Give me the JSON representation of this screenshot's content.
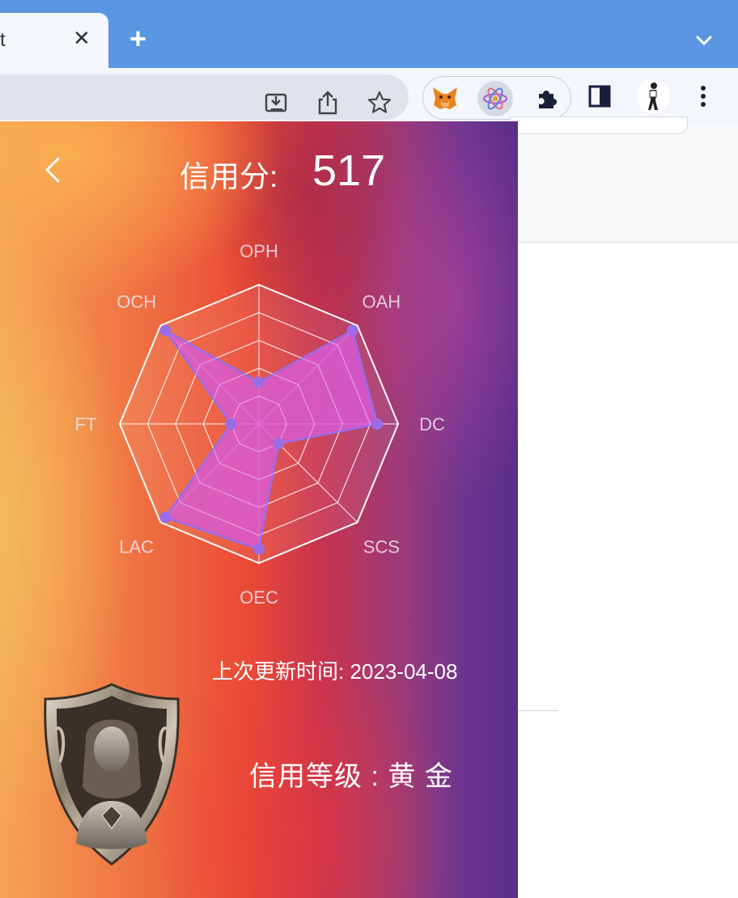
{
  "browser": {
    "tab_title": "t",
    "close_glyph": "✕",
    "new_tab_glyph": "+",
    "tab_list_icon": "chevron-down-icon",
    "omnibox_icons": [
      "install-app-icon",
      "share-icon",
      "bookmark-star-icon"
    ],
    "extensions": [
      "metamask-fox-icon",
      "react-devtools-icon",
      "extensions-puzzle-icon"
    ],
    "toolbar_icons": [
      "side-panel-icon",
      "profile-avatar",
      "more-menu-icon"
    ]
  },
  "panel": {
    "back_icon": "chevron-left-icon",
    "score_label": "信用分:",
    "score_value": "517",
    "last_update": "上次更新时间: 2023-04-08",
    "credit_level": "信用等级 : 黄 金",
    "badge_icon": "shield-portrait-badge"
  },
  "chart_data": {
    "type": "radar",
    "axes": [
      "OPH",
      "OAH",
      "DC",
      "SCS",
      "OEC",
      "LAC",
      "FT",
      "OCH"
    ],
    "axis_label_display": [
      "OPH",
      "OAH",
      "DC",
      "SCS",
      "OEC",
      "LAC",
      "FT",
      "OCH"
    ],
    "series": [
      {
        "values": [
          0.3,
          0.95,
          0.85,
          0.2,
          0.9,
          0.95,
          0.2,
          0.95
        ]
      }
    ],
    "max": 1,
    "rings": 5,
    "grid": true,
    "series_color": "#d85ad6",
    "point_color": "#9a6ce8",
    "grid_color": "#ffffff"
  }
}
